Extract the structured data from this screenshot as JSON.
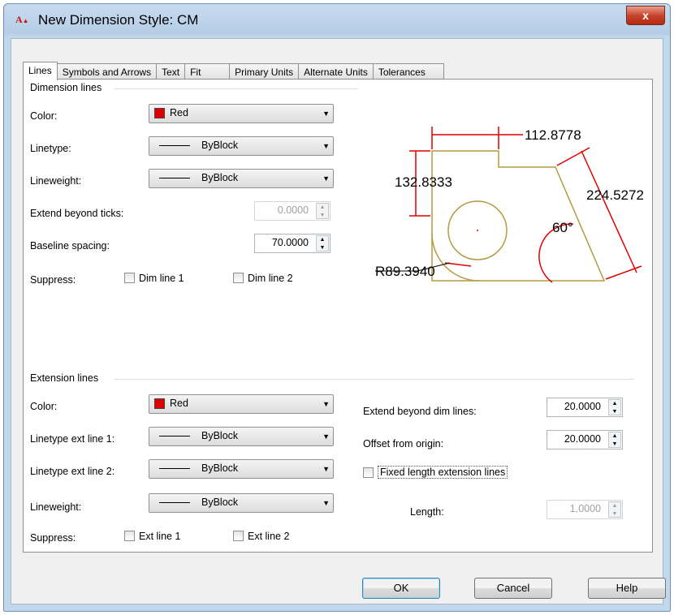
{
  "window": {
    "title": "New Dimension Style: CM",
    "app_icon_text": "A",
    "close_glyph": "x"
  },
  "tabs": [
    {
      "label": "Lines",
      "active": true
    },
    {
      "label": "Symbols and Arrows"
    },
    {
      "label": "Text"
    },
    {
      "label": "Fit"
    },
    {
      "label": "Primary Units"
    },
    {
      "label": "Alternate Units"
    },
    {
      "label": "Tolerances"
    }
  ],
  "dimension_lines": {
    "group_label": "Dimension lines",
    "color_label": "Color:",
    "color_value": "Red",
    "linetype_label": "Linetype:",
    "linetype_value": "ByBlock",
    "lineweight_label": "Lineweight:",
    "lineweight_value": "ByBlock",
    "extend_label": "Extend beyond ticks:",
    "extend_value": "0.0000",
    "baseline_label": "Baseline spacing:",
    "baseline_value": "70.0000",
    "suppress_label": "Suppress:",
    "dim_line1": "Dim line 1",
    "dim_line2": "Dim line 2"
  },
  "extension_lines": {
    "group_label": "Extension lines",
    "color_label": "Color:",
    "color_value": "Red",
    "linetype1_label": "Linetype ext line 1:",
    "linetype1_value": "ByBlock",
    "linetype2_label": "Linetype ext line 2:",
    "linetype2_value": "ByBlock",
    "lineweight_label": "Lineweight:",
    "lineweight_value": "ByBlock",
    "suppress_label": "Suppress:",
    "ext_line1": "Ext line 1",
    "ext_line2": "Ext line 2",
    "extend_dim_label": "Extend beyond dim lines:",
    "extend_dim_value": "20.0000",
    "offset_label": "Offset from origin:",
    "offset_value": "20.0000",
    "fixed_length_label": "Fixed length extension lines",
    "length_label": "Length:",
    "length_value": "1.0000"
  },
  "preview": {
    "dim_top": "112.8778",
    "dim_left": "132.8333",
    "dim_right": "224.5272",
    "dim_angle": "60°",
    "dim_radius": "R89.3940"
  },
  "buttons": {
    "ok": "OK",
    "cancel": "Cancel",
    "help": "Help"
  },
  "colors": {
    "accent_red": "#e00000",
    "geometry": "#b59a40",
    "dim": "#e00000"
  }
}
